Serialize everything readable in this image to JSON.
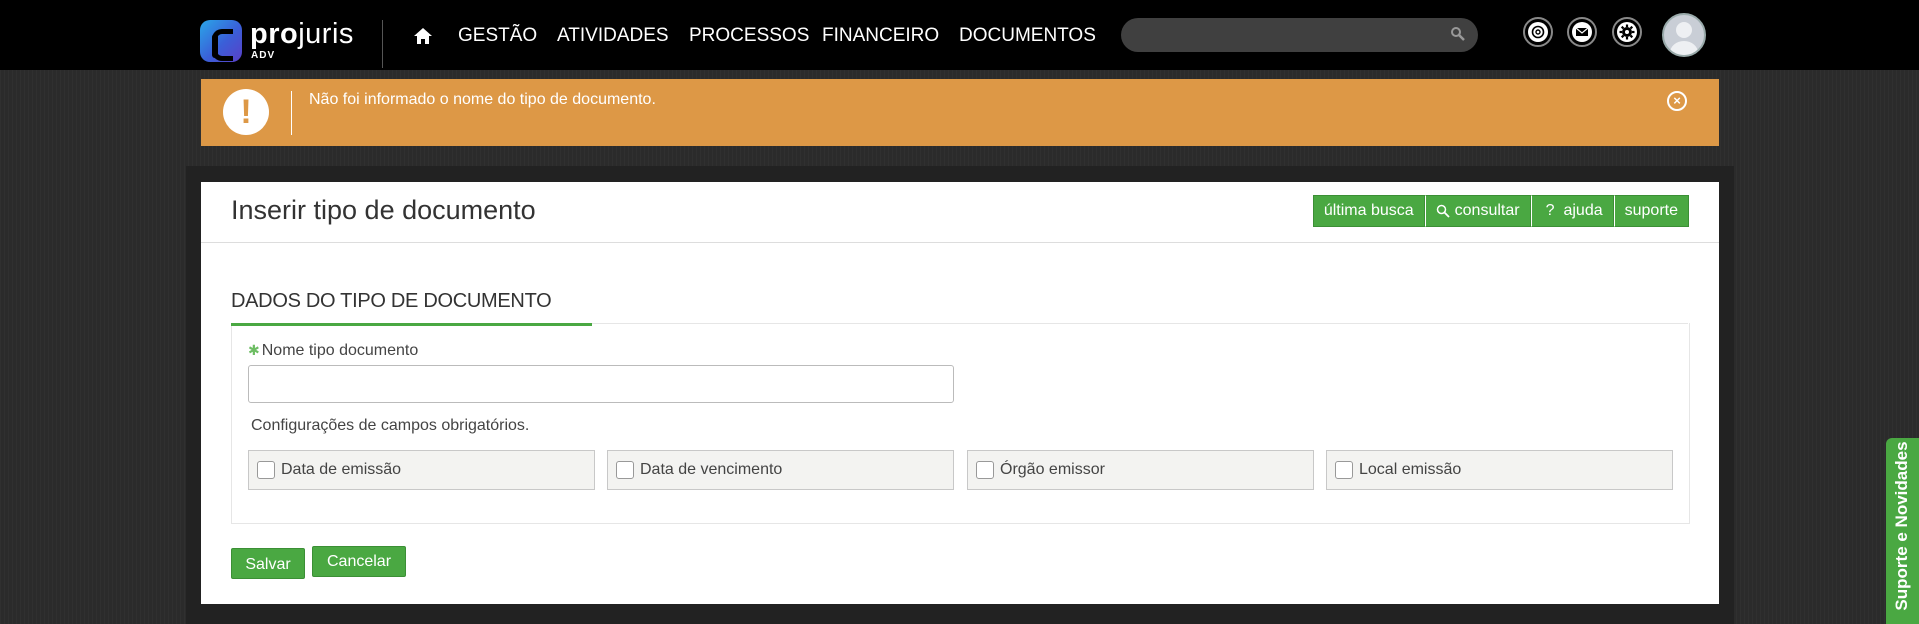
{
  "header": {
    "logo_text_bold": "pro",
    "logo_text_regular": "juris",
    "logo_sub": "ADV",
    "nav": [
      "GESTÃO",
      "ATIVIDADES",
      "PROCESSOS",
      "FINANCEIRO",
      "DOCUMENTOS"
    ],
    "search_placeholder": "",
    "icons": [
      "home-icon",
      "search-icon",
      "openai-icon",
      "mail-icon",
      "gear-icon",
      "user-avatar"
    ]
  },
  "alert": {
    "message": "Não foi informado o nome do tipo de documento.",
    "icon": "!",
    "close": "×",
    "color": "#dd9846"
  },
  "page": {
    "title": "Inserir tipo de documento",
    "actions": {
      "last_search": "última busca",
      "consult": "consultar",
      "help": "ajuda",
      "help_prefix": "?",
      "support": "suporte"
    },
    "section_title": "DADOS DO TIPO DE DOCUMENTO",
    "field_label": "Nome tipo documento",
    "required_mark": "✱",
    "field_value": "",
    "config_text": "Configurações de campos obrigatórios.",
    "checkboxes": [
      "Data de emissão",
      "Data de vencimento",
      "Órgão emissor",
      "Local emissão"
    ],
    "save": "Salvar",
    "cancel": "Cancelar"
  },
  "sidetab": "Suporte e Novidades",
  "colors": {
    "accent_green": "#4aa842",
    "alert_orange": "#dd9846",
    "topbar": "#000000"
  }
}
